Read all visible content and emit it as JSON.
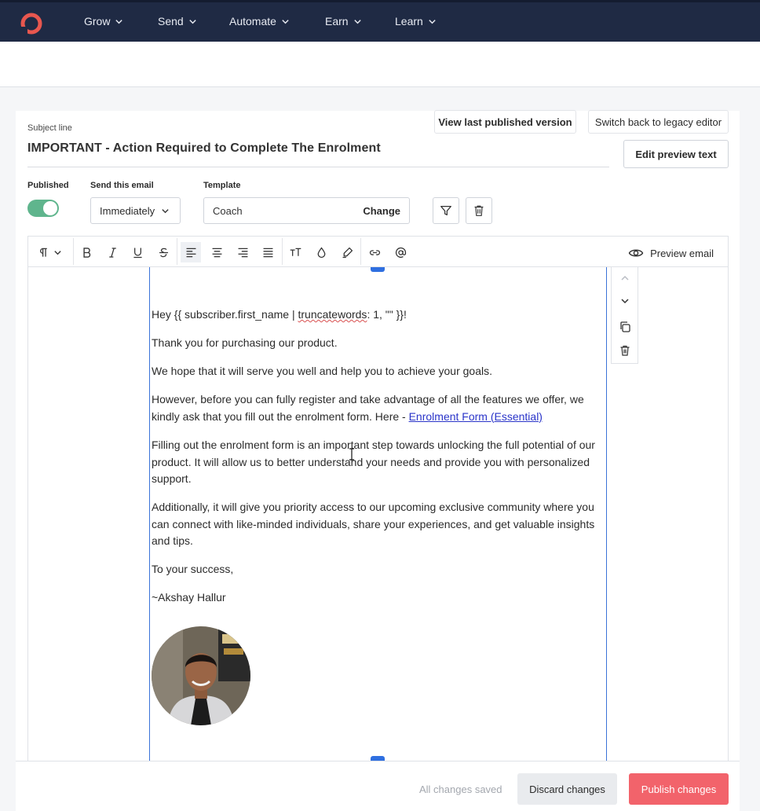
{
  "nav": {
    "items": [
      {
        "label": "Grow"
      },
      {
        "label": "Send"
      },
      {
        "label": "Automate"
      },
      {
        "label": "Earn"
      },
      {
        "label": "Learn"
      }
    ]
  },
  "header": {
    "view_last_published": "View last published version",
    "switch_legacy": "Switch back to legacy editor",
    "edit_preview_text": "Edit preview text"
  },
  "subject": {
    "label": "Subject line",
    "value": "IMPORTANT - Action Required to Complete The Enrolment"
  },
  "settings": {
    "published_label": "Published",
    "published_on": true,
    "send_label": "Send this email",
    "send_value": "Immediately",
    "template_label": "Template",
    "template_value": "Coach",
    "template_change": "Change"
  },
  "toolbar": {
    "preview_label": "Preview email"
  },
  "email_body": {
    "greeting_pre": "Hey {{ subscriber.first_name | ",
    "greeting_squiggle": "truncatewords",
    "greeting_post": ": 1, \"\" }}!",
    "p1": "Thank you for purchasing our product.",
    "p2": "We hope that it will serve you well and help you to achieve your goals.",
    "p3": "However, before you can fully register and take advantage of all the features we offer, we kindly ask that you fill out the enrolment form. Here - ",
    "p3_link": "Enrolment Form (Essential)",
    "p4": "Filling out the enrolment form is an important step towards unlocking the full potential of our product. It will allow us to better understand your needs and provide you with personalized support.",
    "p5": "Additionally, it will give you priority access to our upcoming exclusive community where you can connect with like-minded individuals, share your experiences, and get valuable insights and tips.",
    "p6": "To your success,",
    "p7": "~Akshay Hallur"
  },
  "footer": {
    "status": "All changes saved",
    "discard": "Discard changes",
    "publish": "Publish changes"
  },
  "colors": {
    "nav_bg": "#1f2a44",
    "accent_red": "#f2636b",
    "toggle_green": "#5fb58d",
    "block_border": "#3b73d8",
    "link": "#2a34c9"
  }
}
